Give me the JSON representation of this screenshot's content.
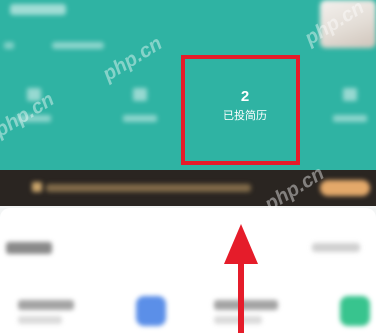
{
  "header": {
    "focused_stat": {
      "count": "2",
      "label": "已投简历"
    }
  },
  "watermark": {
    "text": "php.cn"
  },
  "colors": {
    "header_bg": "#2fb3a3",
    "banner_bg": "#2a2521",
    "highlight": "#e51c2a",
    "banner_button": "#e4a96a"
  }
}
